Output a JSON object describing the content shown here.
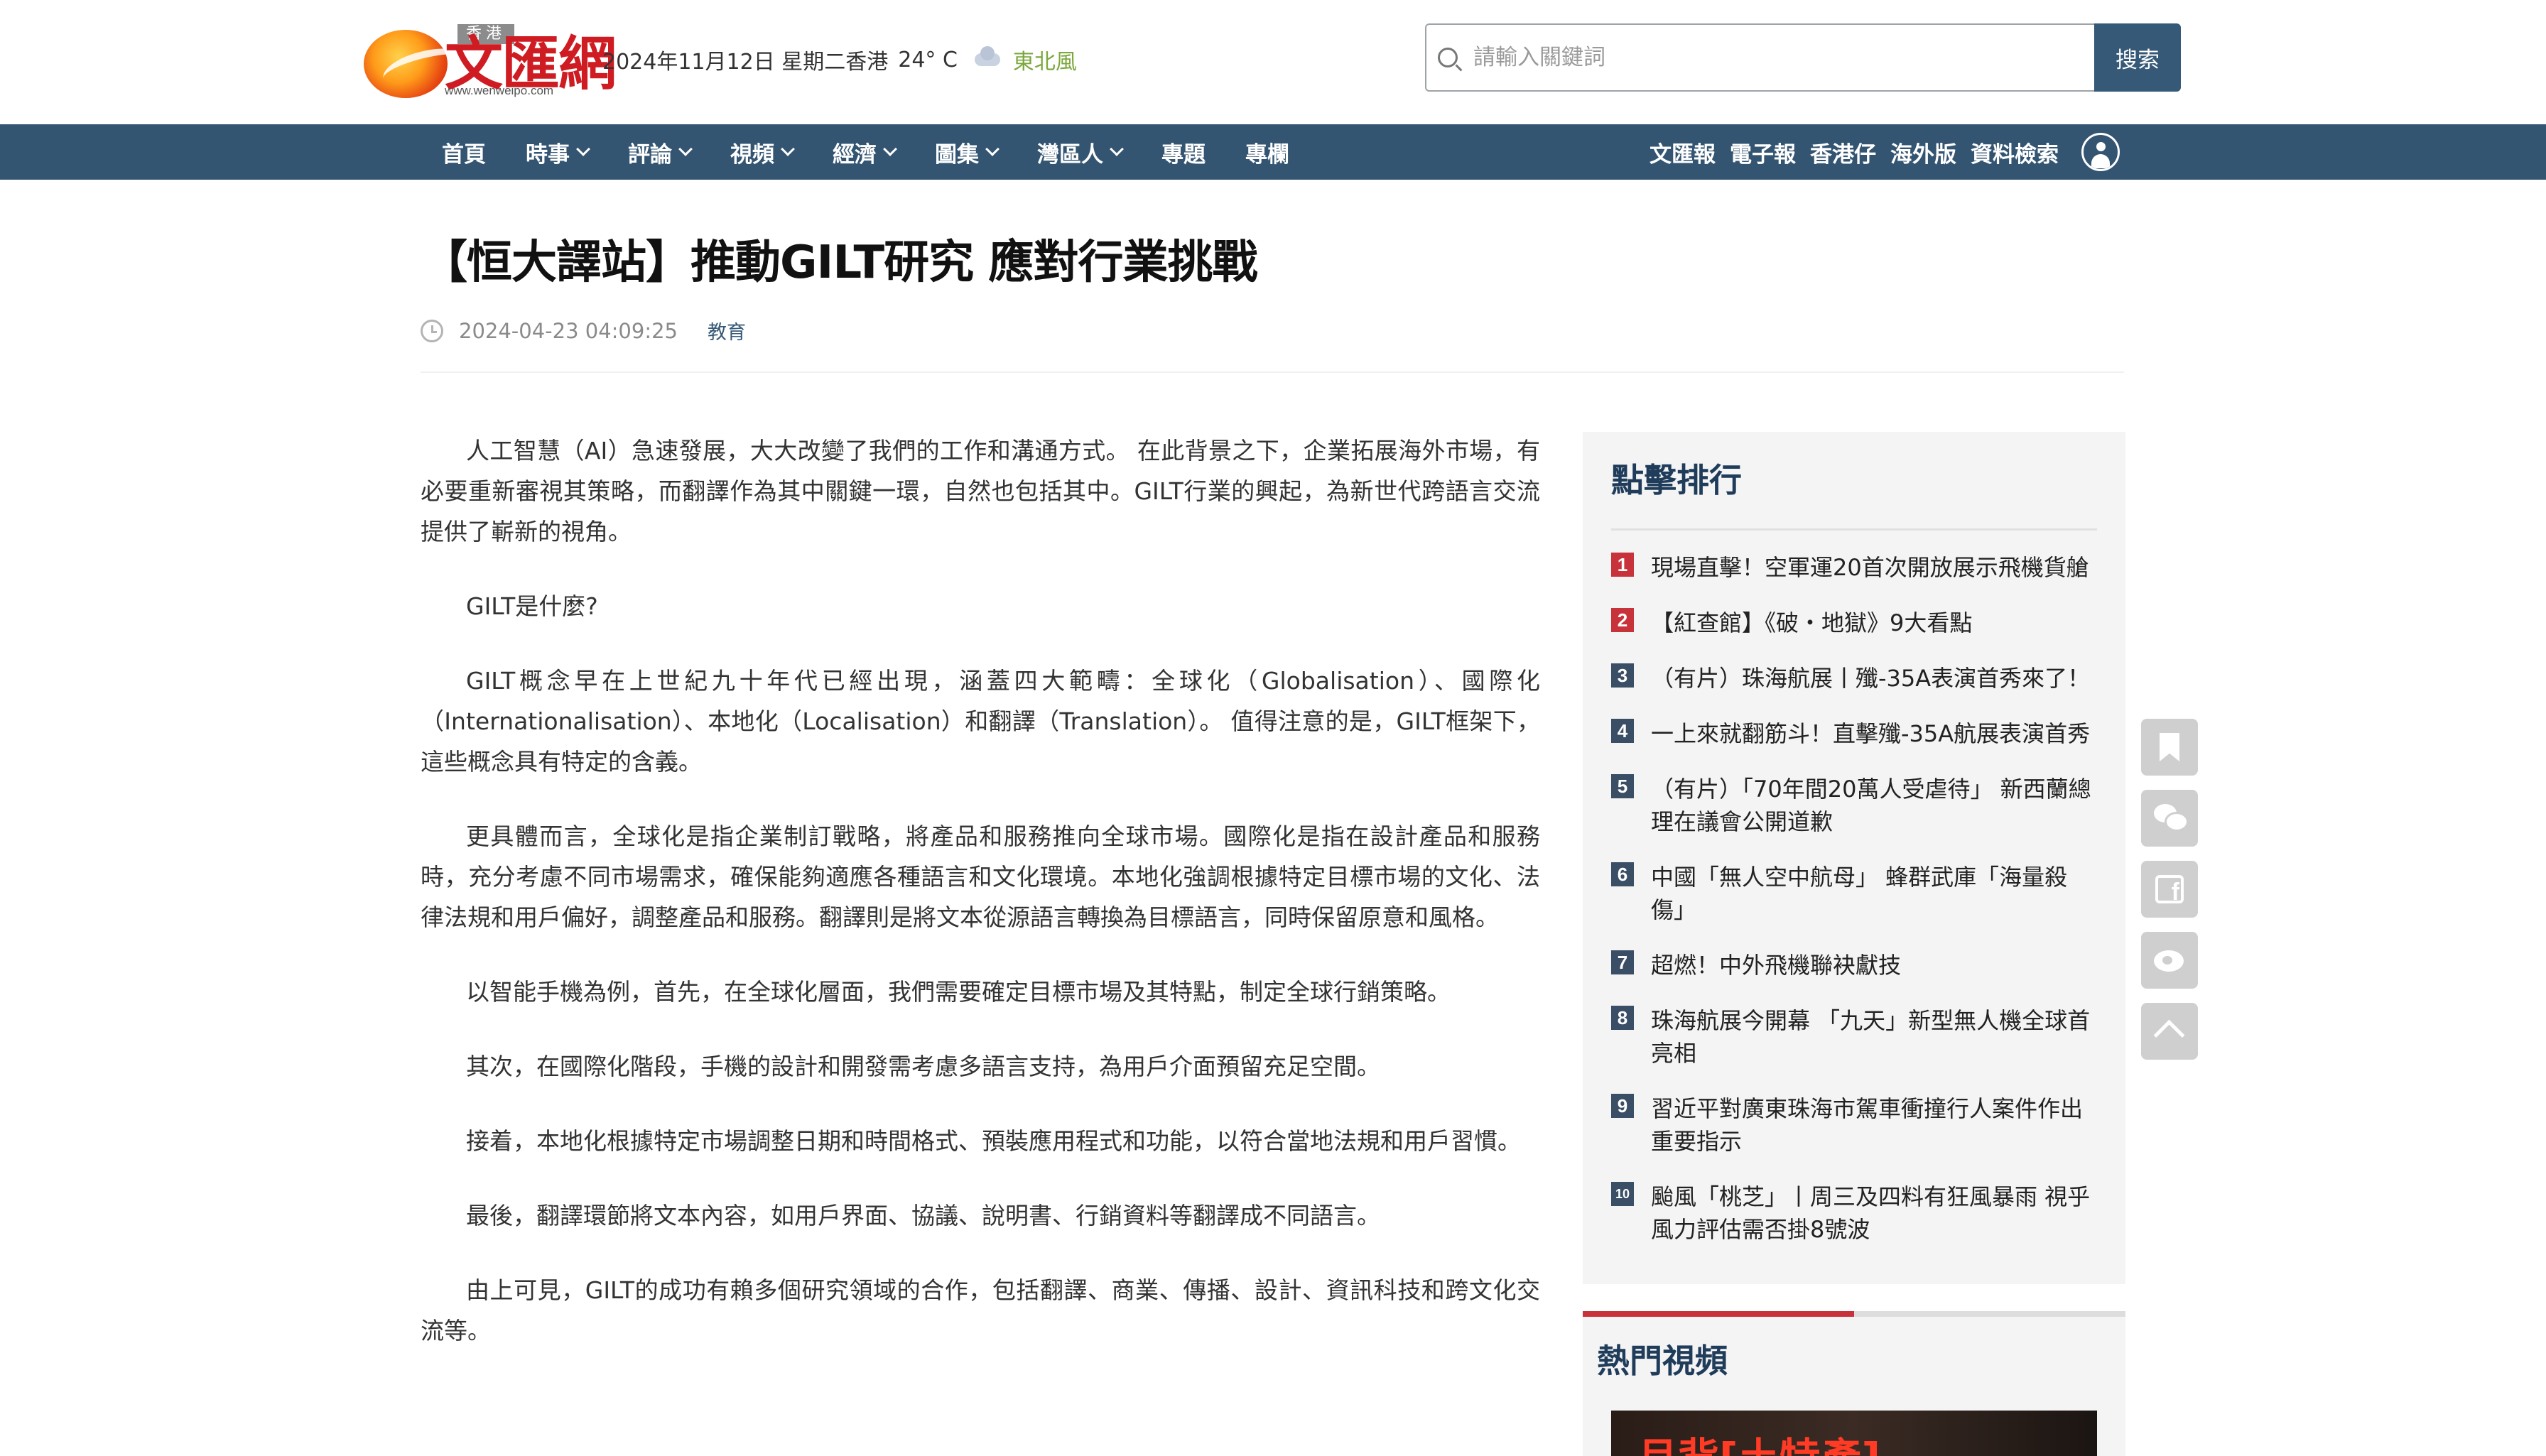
{
  "header": {
    "logo_tag": "香港",
    "logo_main": "文匯網",
    "logo_url": "www.wenweipo.com",
    "date": "2024年11月12日 星期二",
    "city": "香港",
    "temperature": "24° C",
    "weather_icon": "cloud-icon",
    "wind": "東北風",
    "search_placeholder": "請輸入關鍵詞",
    "search_button": "搜索"
  },
  "nav": {
    "left": [
      {
        "label": "首頁",
        "dropdown": false
      },
      {
        "label": "時事",
        "dropdown": true
      },
      {
        "label": "評論",
        "dropdown": true
      },
      {
        "label": "視頻",
        "dropdown": true
      },
      {
        "label": "經濟",
        "dropdown": true
      },
      {
        "label": "圖集",
        "dropdown": true
      },
      {
        "label": "灣區人",
        "dropdown": true
      },
      {
        "label": "專題",
        "dropdown": false
      },
      {
        "label": "專欄",
        "dropdown": false
      }
    ],
    "right": [
      "文匯報",
      "電子報",
      "香港仔",
      "海外版",
      "資料檢索"
    ],
    "user_icon": "user-icon"
  },
  "article": {
    "title": "【恒大譯站】推動GILT研究 應對行業挑戰",
    "datetime": "2024-04-23 04:09:25",
    "category": "教育",
    "paragraphs": [
      "人工智慧（AI）急速發展，大大改變了我們的工作和溝通方式。 在此背景之下，企業拓展海外市場，有必要重新審視其策略，而翻譯作為其中關鍵一環，自然也包括其中。GILT行業的興起，為新世代跨語言交流提供了嶄新的視角。",
      "GILT是什麼?",
      "GILT概念早在上世紀九十年代已經出現，涵蓋四大範疇：全球化（Globalisation）、國際化（Internationalisation）、本地化（Localisation）和翻譯（Translation）。 值得注意的是，GILT框架下，這些概念具有特定的含義。",
      "更具體而言，全球化是指企業制訂戰略，將產品和服務推向全球市場。國際化是指在設計產品和服務時，充分考慮不同市場需求，確保能夠適應各種語言和文化環境。本地化強調根據特定目標市場的文化、法律法規和用戶偏好，調整產品和服務。翻譯則是將文本從源語言轉換為目標語言，同時保留原意和風格。",
      "以智能手機為例，首先，在全球化層面，我們需要確定目標市場及其特點，制定全球行銷策略。",
      "其次，在國際化階段，手機的設計和開發需考慮多語言支持，為用戶介面預留充足空間。",
      "接着，本地化根據特定市場調整日期和時間格式、預裝應用程式和功能，以符合當地法規和用戶習慣。",
      "最後，翻譯環節將文本內容，如用戶界面、協議、說明書、行銷資料等翻譯成不同語言。",
      "由上可見，GILT的成功有賴多個研究領域的合作，包括翻譯、商業、傳播、設計、資訊科技和跨文化交流等。"
    ]
  },
  "sidebar": {
    "ranking_title": "點擊排行",
    "ranking": [
      {
        "num": "1",
        "text": "現場直擊！空軍運20首次開放展示飛機貨艙"
      },
      {
        "num": "2",
        "text": "【紅查館】《破・地獄》9大看點"
      },
      {
        "num": "3",
        "text": "（有片）珠海航展丨殲-35A表演首秀來了！"
      },
      {
        "num": "4",
        "text": "一上來就翻筋斗！直擊殲-35A航展表演首秀"
      },
      {
        "num": "5",
        "text": "（有片）「70年間20萬人受虐待」 新西蘭總理在議會公開道歉"
      },
      {
        "num": "6",
        "text": "中國「無人空中航母」 蜂群武庫「海量殺傷」"
      },
      {
        "num": "7",
        "text": "超燃！中外飛機聯袂獻技"
      },
      {
        "num": "8",
        "text": "珠海航展今開幕 「九天」新型無人機全球首亮相"
      },
      {
        "num": "9",
        "text": "習近平對廣東珠海市駕車衝撞行人案件作出重要指示"
      },
      {
        "num": "10",
        "text": "颱風「桃芝」丨周三及四料有狂風暴雨 視乎風力評估需否掛8號波"
      }
    ],
    "video_title": "熱門視頻",
    "video_thumb_text": "月背[土特產]"
  },
  "share": {
    "icons": [
      "bookmark-icon",
      "wechat-icon",
      "facebook-icon",
      "weibo-icon",
      "back-to-top-icon"
    ]
  }
}
